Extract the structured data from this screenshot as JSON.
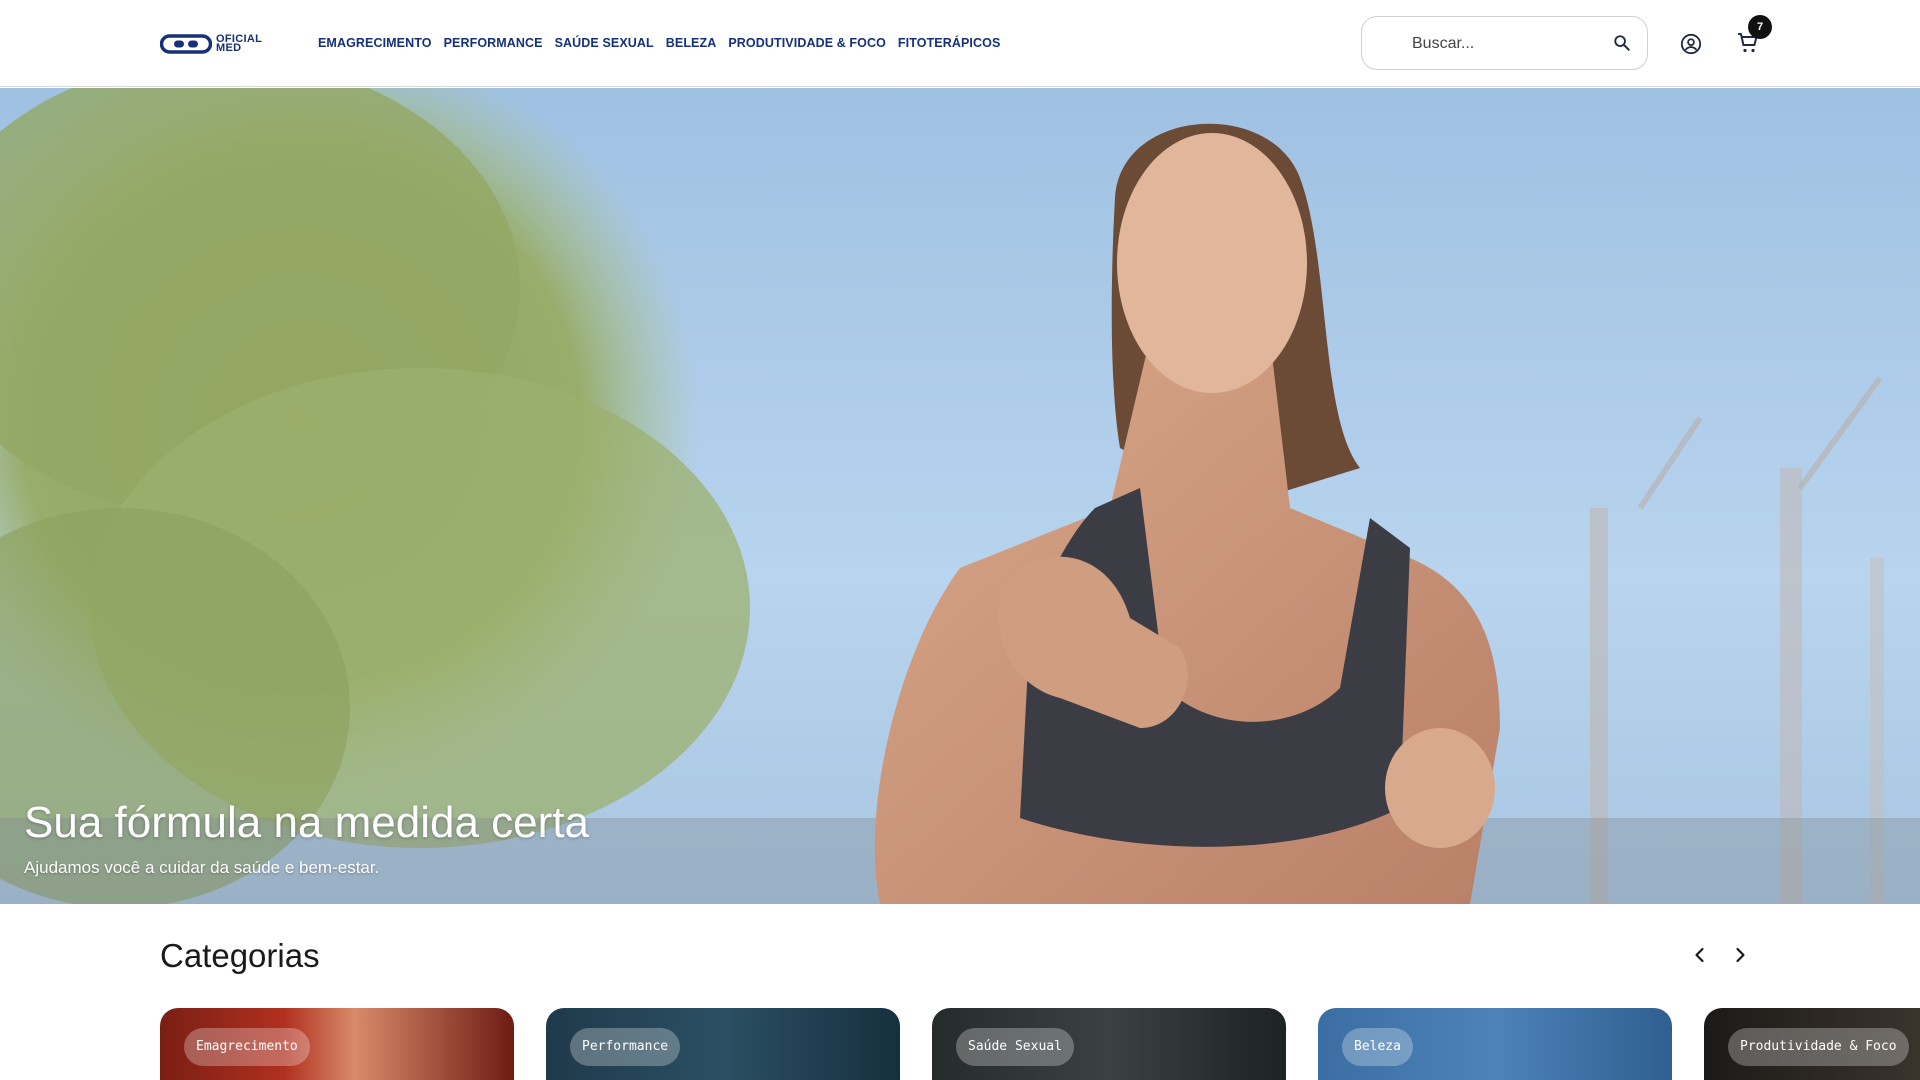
{
  "header": {
    "logo_text_line1": "OFICIAL",
    "logo_text_line2": "MED",
    "nav": [
      "EMAGRECIMENTO",
      "PERFORMANCE",
      "SAÚDE SEXUAL",
      "BELEZA",
      "PRODUTIVIDADE & FOCO",
      "FITOTERÁPICOS"
    ],
    "search_placeholder": "Buscar...",
    "cart_count": "7",
    "brand_color": "#16307a"
  },
  "hero": {
    "title": "Sua fórmula na medida certa",
    "subtitle": "Ajudamos você a cuidar da saúde e bem-estar."
  },
  "categories": {
    "title": "Categorias",
    "items": [
      "Emagrecimento",
      "Performance",
      "Saúde Sexual",
      "Beleza",
      "Produtividade & Foco"
    ]
  }
}
